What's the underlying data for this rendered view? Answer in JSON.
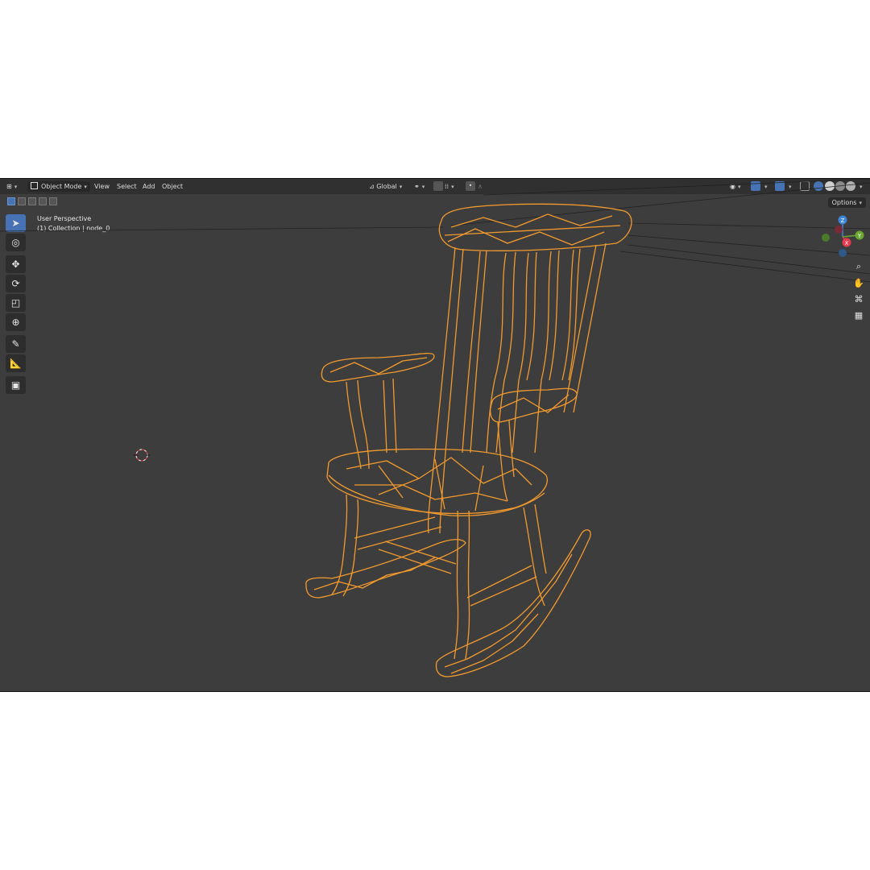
{
  "header": {
    "mode": "Object Mode",
    "menus": [
      "View",
      "Select",
      "Add",
      "Object"
    ],
    "transform_orientation": "Global"
  },
  "overlay": {
    "view_name": "User Perspective",
    "collection_line": "(1) Collection | node_0"
  },
  "options_label": "Options",
  "gizmo": {
    "z": "Z",
    "y": "Y",
    "x": "X"
  },
  "colors": {
    "viewport_bg": "#3d3d3d",
    "header_bg": "#303030",
    "active_tool": "#4772b3",
    "wireframe": "#f29a2e",
    "axis_x": "#e8394f",
    "axis_y": "#6ba832",
    "axis_z": "#3d85d6"
  },
  "icons": {
    "editor_type": "editor-type-icon",
    "tools": [
      "select-box-icon",
      "cursor-icon",
      "move-icon",
      "rotate-icon",
      "scale-icon",
      "transform-icon",
      "annotate-icon",
      "measure-icon",
      "add-cube-icon"
    ],
    "nav": [
      "zoom-icon",
      "pan-hand-icon",
      "camera-icon",
      "grid-icon"
    ]
  }
}
